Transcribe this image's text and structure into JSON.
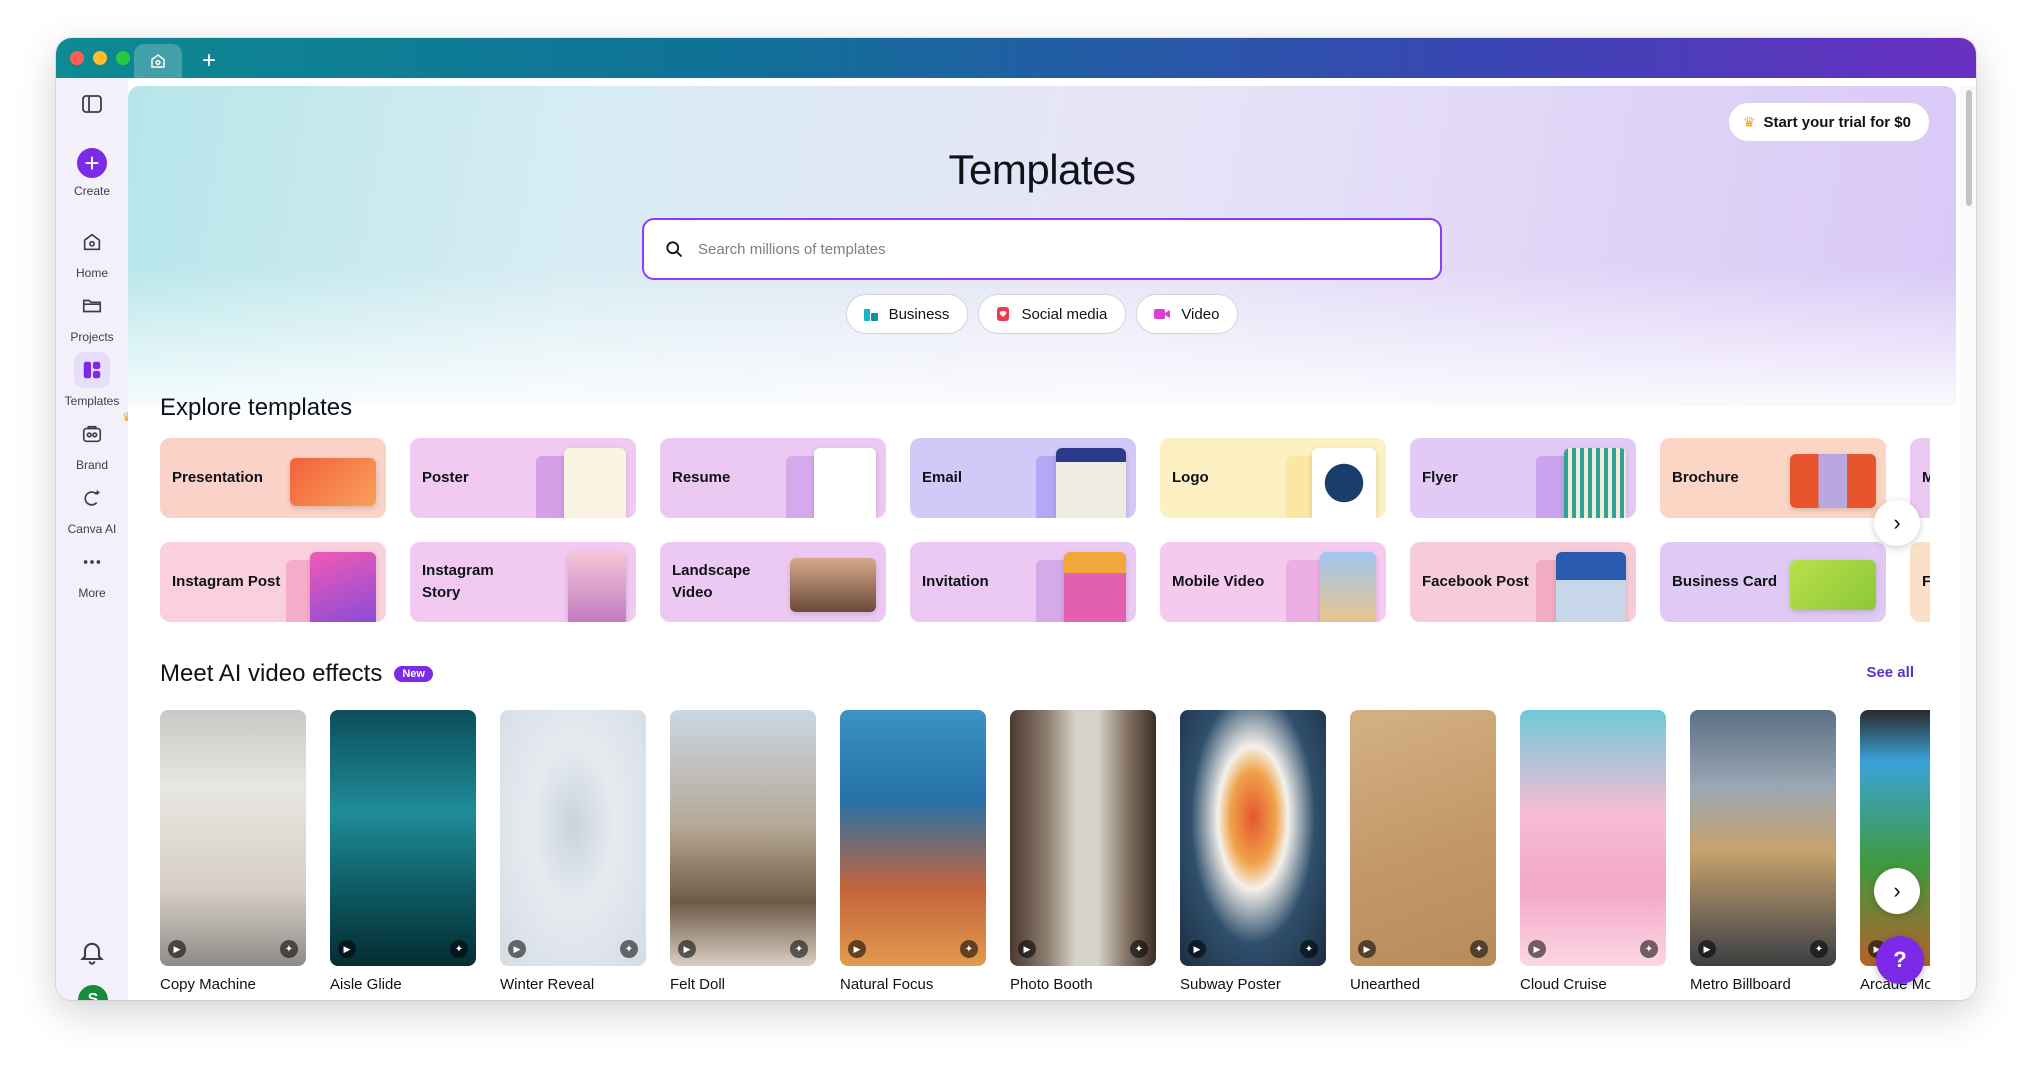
{
  "browser": {
    "home_tab_icon": "home-icon",
    "new_tab_label": "+"
  },
  "sidebar": {
    "items": [
      {
        "label": "Create",
        "icon": "plus-icon"
      },
      {
        "label": "Home",
        "icon": "home-icon"
      },
      {
        "label": "Projects",
        "icon": "folder-icon"
      },
      {
        "label": "Templates",
        "icon": "templates-icon"
      },
      {
        "label": "Brand",
        "icon": "brand-icon"
      },
      {
        "label": "Canva AI",
        "icon": "canva-ai-icon"
      },
      {
        "label": "More",
        "icon": "more-icon"
      }
    ],
    "avatar_initial": "S"
  },
  "header": {
    "trial_label": "Start your trial for $0",
    "title": "Templates",
    "search_placeholder": "Search millions of templates",
    "chips": [
      "Business",
      "Social media",
      "Video"
    ]
  },
  "explore": {
    "title": "Explore templates",
    "row1": [
      "Presentation",
      "Poster",
      "Resume",
      "Email",
      "Logo",
      "Flyer",
      "Brochure",
      "M"
    ],
    "row2": [
      "Instagram Post",
      "Instagram Story",
      "Landscape Video",
      "Invitation",
      "Mobile Video",
      "Facebook Post",
      "Business Card",
      "F"
    ]
  },
  "ai_effects": {
    "title": "Meet AI video effects",
    "badge": "New",
    "see_all": "See all",
    "items": [
      "Copy Machine",
      "Aisle Glide",
      "Winter Reveal",
      "Felt Doll",
      "Natural Focus",
      "Photo Booth",
      "Subway Poster",
      "Unearthed",
      "Cloud Cruise",
      "Metro Billboard",
      "Arcade Mod"
    ]
  },
  "help_label": "?",
  "colors": {
    "accent": "#7d2ae8",
    "search_border": "#8b3dff",
    "see_all": "#5a32c8"
  }
}
